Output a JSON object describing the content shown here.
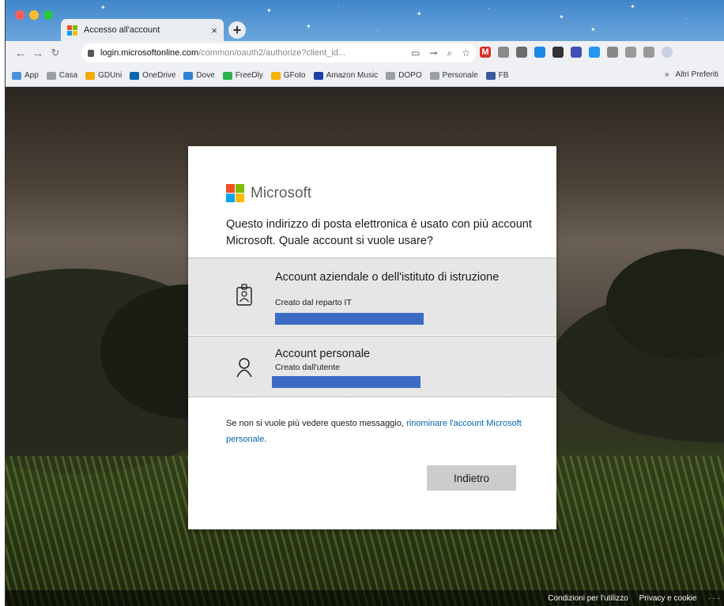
{
  "browser": {
    "tab_title": "Accesso all'account",
    "tab_close": "×",
    "new_tab": "+",
    "url_host": "login.microsoftonline.com",
    "url_path": "/common/oauth2/authorize?client_id...",
    "bookmarks": [
      {
        "label": "App",
        "color": "#4a90d9"
      },
      {
        "label": "Casa",
        "color": "#9aa0a6"
      },
      {
        "label": "GDUni",
        "color": "#f2a900"
      },
      {
        "label": "OneDrive",
        "color": "#0a64ad"
      },
      {
        "label": "Dove",
        "color": "#2f7fd6"
      },
      {
        "label": "FreeDly",
        "color": "#2bb24c"
      },
      {
        "label": "GFoto",
        "color": "#f4b400"
      },
      {
        "label": "Amazon Music",
        "color": "#1a3fa8"
      },
      {
        "label": "DOPO",
        "color": "#9aa0a6"
      },
      {
        "label": "Personale",
        "color": "#9aa0a6"
      },
      {
        "label": "FB",
        "color": "#3b5998"
      }
    ],
    "bookmarks_more": "»",
    "bookmarks_other": "Altri Preferiti"
  },
  "dialog": {
    "brand": "Microsoft",
    "prompt": "Questo indirizzo di posta elettronica è usato con più account Microsoft. Quale account si vuole usare?",
    "accounts": [
      {
        "title": "Account aziendale o dell'istituto di istruzione",
        "subtitle": "Creato dal reparto IT",
        "icon": "badge-icon"
      },
      {
        "title": "Account personale",
        "subtitle": "Creato dall'utente",
        "icon": "person-icon"
      }
    ],
    "note_prefix": "Se non si vuole più vedere questo messaggio, ",
    "note_link": "rinominare l'account Microsoft personale",
    "note_suffix": ".",
    "back_button": "Indietro"
  },
  "footer": {
    "terms": "Condizioni per l'utilizzo",
    "privacy": "Privacy e cookie",
    "more": "· · ·"
  },
  "colors": {
    "ms_red": "#f25022",
    "ms_green": "#7fba00",
    "ms_blue": "#00a4ef",
    "ms_yellow": "#ffb900",
    "link": "#0067b8",
    "redaction": "#3c6bc4"
  }
}
